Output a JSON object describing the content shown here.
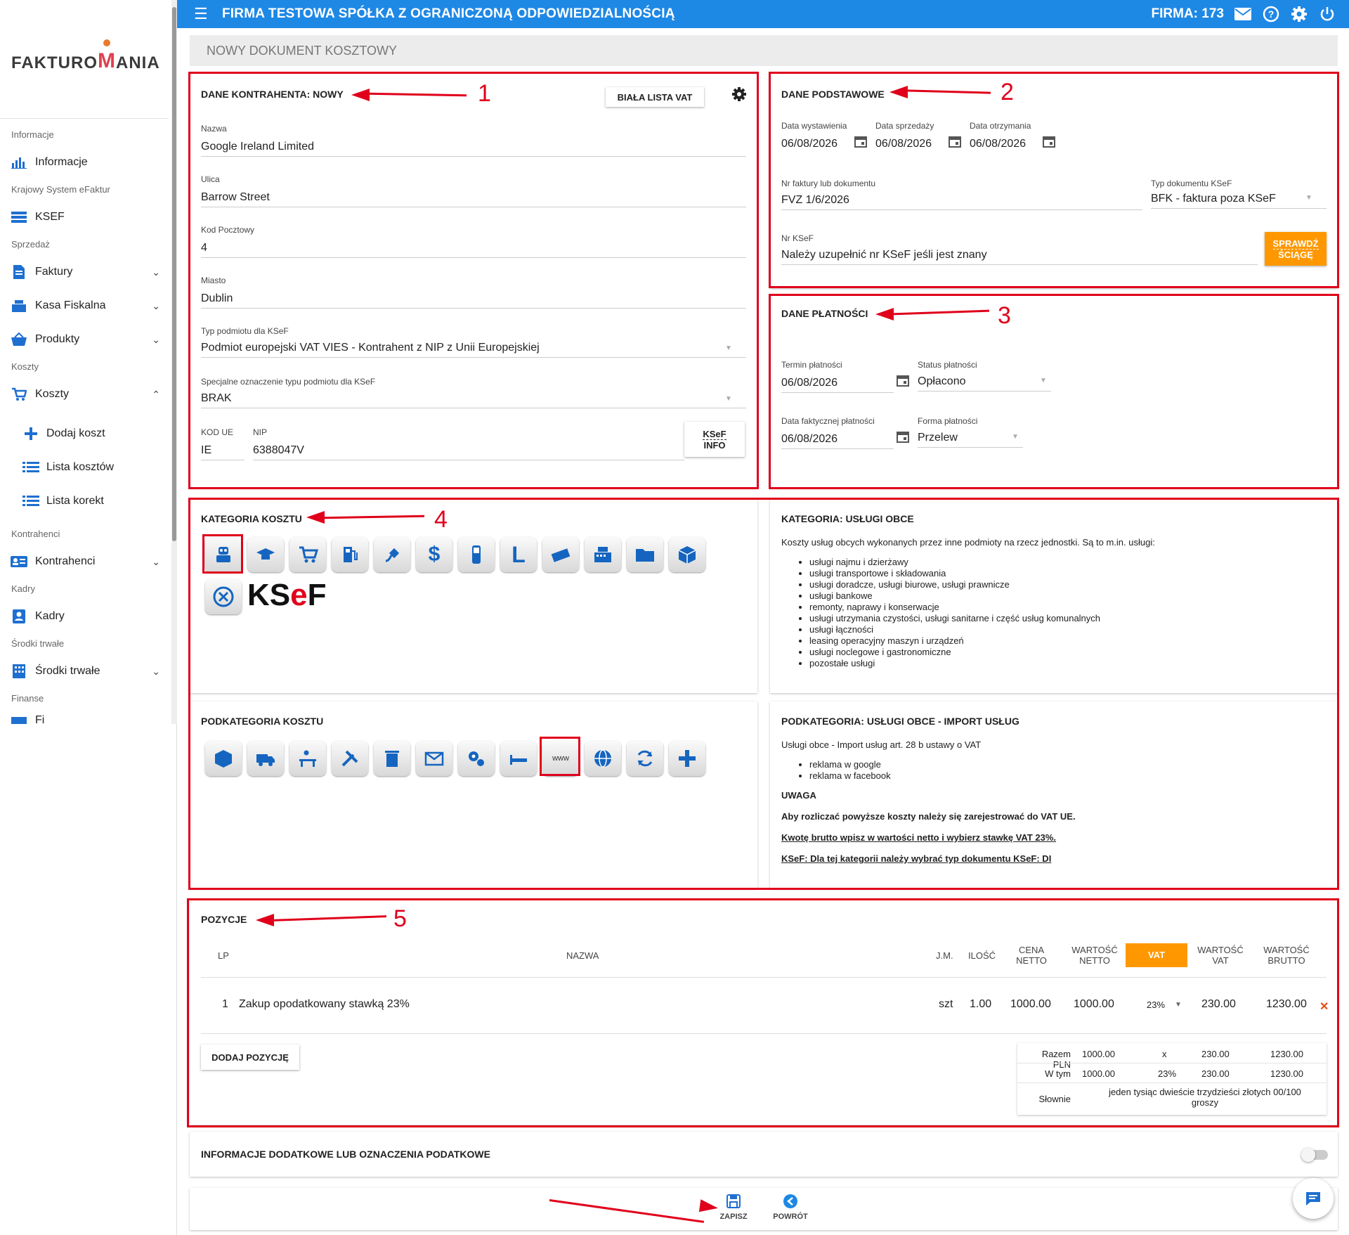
{
  "sidebar": {
    "logo": {
      "part1": "FAKTURO",
      "part2": "M",
      "part3": "ANIA"
    },
    "sections": [
      "Informacje",
      "Krajowy System eFaktur",
      "Sprzedaż",
      "Koszty",
      "Kontrahenci",
      "Kadry",
      "Środki trwałe",
      "Finanse"
    ],
    "items": {
      "informacje": "Informacje",
      "ksef": "KSEF",
      "faktury": "Faktury",
      "kasa": "Kasa Fiskalna",
      "produkty": "Produkty",
      "koszty": "Koszty",
      "dodaj_koszt": "Dodaj koszt",
      "lista_kosztow": "Lista kosztów",
      "lista_korekt": "Lista korekt",
      "kontrahenci": "Kontrahenci",
      "kadry": "Kadry",
      "srodki": "Środki trwałe",
      "finanse_partial": "Fi"
    }
  },
  "topbar": {
    "title": "FIRMA TESTOWA SPÓŁKA Z OGRANICZONĄ ODPOWIEDZIALNOŚCIĄ",
    "firma": "FIRMA: 173"
  },
  "docbar": {
    "title": "NOWY DOKUMENT KOSZTOWY"
  },
  "kontrahent": {
    "title": "DANE KONTRAHENTA: NOWY",
    "biala_lista": "BIAŁA LISTA VAT",
    "nazwa_label": "Nazwa",
    "nazwa": "Google Ireland Limited",
    "ulica_label": "Ulica",
    "ulica": "Barrow Street",
    "kod_label": "Kod Pocztowy",
    "kod": "4",
    "miasto_label": "Miasto",
    "miasto": "Dublin",
    "typ_label": "Typ podmiotu dla KSeF",
    "typ": "Podmiot europejski VAT VIES - Kontrahent z NIP z Unii Europejskiej",
    "spec_label": "Specjalne oznaczenie typu podmiotu dla KSeF",
    "spec": "BRAK",
    "kodue_label": "KOD UE",
    "kodue": "IE",
    "nip_label": "NIP",
    "nip": "6388047V",
    "ksef_info_1": "KSeF",
    "ksef_info_2": "INFO"
  },
  "podstawowe": {
    "title": "DANE PODSTAWOWE",
    "data_wyst_label": "Data wystawienia",
    "data_wyst": "06/08/2026",
    "data_sprz_label": "Data sprzedaży",
    "data_sprz": "06/08/2026",
    "data_otrz_label": "Data otrzymania",
    "data_otrz": "06/08/2026",
    "nr_label": "Nr faktury lub dokumentu",
    "nr": "FVZ 1/6/2026",
    "typdok_label": "Typ dokumentu KSeF",
    "typdok": "BFK - faktura poza KSeF",
    "nrksef_label": "Nr KSeF",
    "nrksef": "Należy uzupełnić nr KSeF jeśli jest znany",
    "sprawdz_1": "SPRAWDŹ",
    "sprawdz_2": "ŚCIĄGĘ"
  },
  "platnosci": {
    "title": "DANE PŁATNOŚCI",
    "termin_label": "Termin płatności",
    "termin": "06/08/2026",
    "status_label": "Status płatności",
    "status": "Opłacono",
    "data_fakt_label": "Data faktycznej płatności",
    "data_fakt": "06/08/2026",
    "forma_label": "Forma płatności",
    "forma": "Przelew"
  },
  "kategoria": {
    "title": "KATEGORIA KOSZTU",
    "ksef_logo_1": "KS",
    "ksef_logo_2": "e",
    "ksef_logo_3": "F"
  },
  "kategoria_desc": {
    "title": "KATEGORIA: USŁUGI OBCE",
    "intro": "Koszty usług obcych wykonanych przez inne podmioty na rzecz jednostki. Są to m.in. usługi:",
    "items": [
      "usługi najmu i dzierżawy",
      "usługi transportowe i składowania",
      "usługi doradcze, usługi biurowe, usługi prawnicze",
      "usługi bankowe",
      "remonty, naprawy i konserwacje",
      "usługi utrzymania czystości, usługi sanitarne i część usług komunalnych",
      "usługi łączności",
      "leasing operacyjny maszyn i urządzeń",
      "usługi noclegowe i gastronomiczne",
      "pozostałe usługi"
    ]
  },
  "podkategoria": {
    "title": "PODKATEGORIA KOSZTU"
  },
  "podkategoria_desc": {
    "title": "PODKATEGORIA: USŁUGI OBCE - IMPORT USŁUG",
    "intro": "Usługi obce - Import usług art. 28 b ustawy o VAT",
    "items": [
      "reklama w google",
      "reklama w facebook"
    ],
    "uwaga": "UWAGA",
    "note1": "Aby rozliczać powyższe koszty należy się zarejestrować do VAT UE.",
    "note2": "Kwotę brutto wpisz w wartości netto i wybierz stawkę VAT 23%.",
    "note3": "KSeF: Dla tej kategorii należy wybrać typ dokumentu KSeF: DI"
  },
  "pozycje": {
    "title": "POZYCJE",
    "headers": {
      "lp": "LP",
      "nazwa": "NAZWA",
      "jm": "J.M.",
      "ilosc": "ILOŚĆ",
      "cena_1": "CENA",
      "cena_2": "NETTO",
      "wn_1": "WARTOŚĆ",
      "wn_2": "NETTO",
      "vat": "VAT",
      "wv_1": "WARTOŚĆ",
      "wv_2": "VAT",
      "wb_1": "WARTOŚĆ",
      "wb_2": "BRUTTO"
    },
    "rows": [
      {
        "lp": "1",
        "nazwa": "Zakup opodatkowany stawką 23%",
        "jm": "szt",
        "ilosc": "1.00",
        "cena": "1000.00",
        "netto": "1000.00",
        "vat": "23%",
        "wvat": "230.00",
        "brutto": "1230.00"
      }
    ],
    "dodaj": "DODAJ POZYCJĘ",
    "summary": {
      "razem_label": "Razem PLN",
      "razem_netto": "1000.00",
      "razem_stawka": "x",
      "razem_vat": "230.00",
      "razem_brutto": "1230.00",
      "wtym_label": "W tym",
      "wtym_netto": "1000.00",
      "wtym_stawka": "23%",
      "wtym_vat": "230.00",
      "wtym_brutto": "1230.00",
      "slownie_label": "Słownie",
      "slownie": "jeden tysiąc dwieście trzydzieści złotych 00/100 groszy"
    }
  },
  "info_dodatkowe": {
    "title": "INFORMACJE DODATKOWE LUB OZNACZENIA PODATKOWE"
  },
  "footer": {
    "zapisz": "ZAPISZ",
    "powrot": "POWRÓT"
  },
  "annotations": [
    "1",
    "2",
    "3",
    "4",
    "5"
  ],
  "colors": {
    "primary": "#1e88e5",
    "accent_orange": "#ff9800",
    "highlight_red": "#e0001b"
  }
}
